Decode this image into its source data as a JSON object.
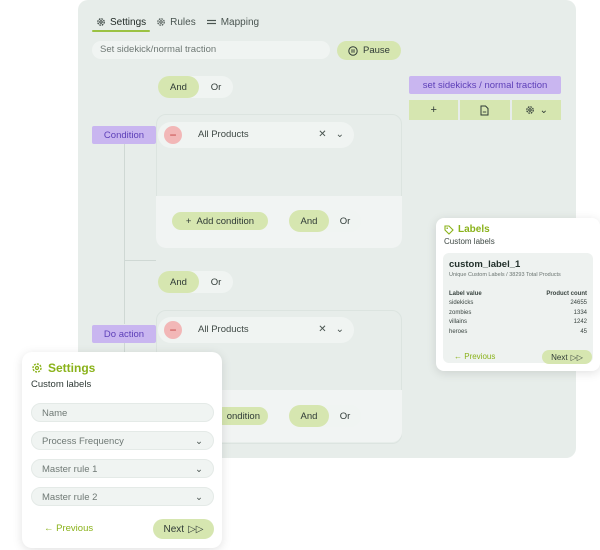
{
  "tabs": [
    {
      "label": "Settings",
      "icon": "gear-icon",
      "active": true
    },
    {
      "label": "Rules",
      "icon": "gear-icon",
      "active": false
    },
    {
      "label": "Mapping",
      "icon": "equals-icon",
      "active": false
    }
  ],
  "search": {
    "value": "Set sidekick/normal traction"
  },
  "pause_label": "Pause",
  "logic": {
    "and": "And",
    "or": "Or"
  },
  "condition_label": "Condition",
  "do_action_label": "Do action",
  "rows": [
    {
      "label": "All Products"
    },
    {
      "label": "All Products"
    }
  ],
  "add_condition_label": "Add condition",
  "add_condition_partial": "ondition",
  "action": {
    "title": "set sidekicks / normal traction"
  },
  "labels_card": {
    "title": "Labels",
    "subtitle": "Custom labels",
    "label_name": "custom_label_1",
    "summary": "Unique Custom Labels / 38293 Total Products",
    "col_value": "Label value",
    "col_count": "Product count",
    "rows": [
      {
        "value": "sidekicks",
        "count": "24655"
      },
      {
        "value": "zombies",
        "count": "1334"
      },
      {
        "value": "villains",
        "count": "1242"
      },
      {
        "value": "heroes",
        "count": "45"
      }
    ],
    "previous": "Previous",
    "next": "Next"
  },
  "settings_card": {
    "title": "Settings",
    "subtitle": "Custom labels",
    "fields": [
      {
        "placeholder": "Name",
        "dropdown": false
      },
      {
        "placeholder": "Process Frequency",
        "dropdown": true
      },
      {
        "placeholder": "Master rule 1",
        "dropdown": true
      },
      {
        "placeholder": "Master rule 2",
        "dropdown": true
      }
    ],
    "previous": "Previous",
    "next": "Next"
  },
  "colors": {
    "accent_green": "#8ab21a",
    "pill_green": "#d6e6b0",
    "tag_purple": "#c9b6f0",
    "remove_red": "#f2b7b7"
  }
}
